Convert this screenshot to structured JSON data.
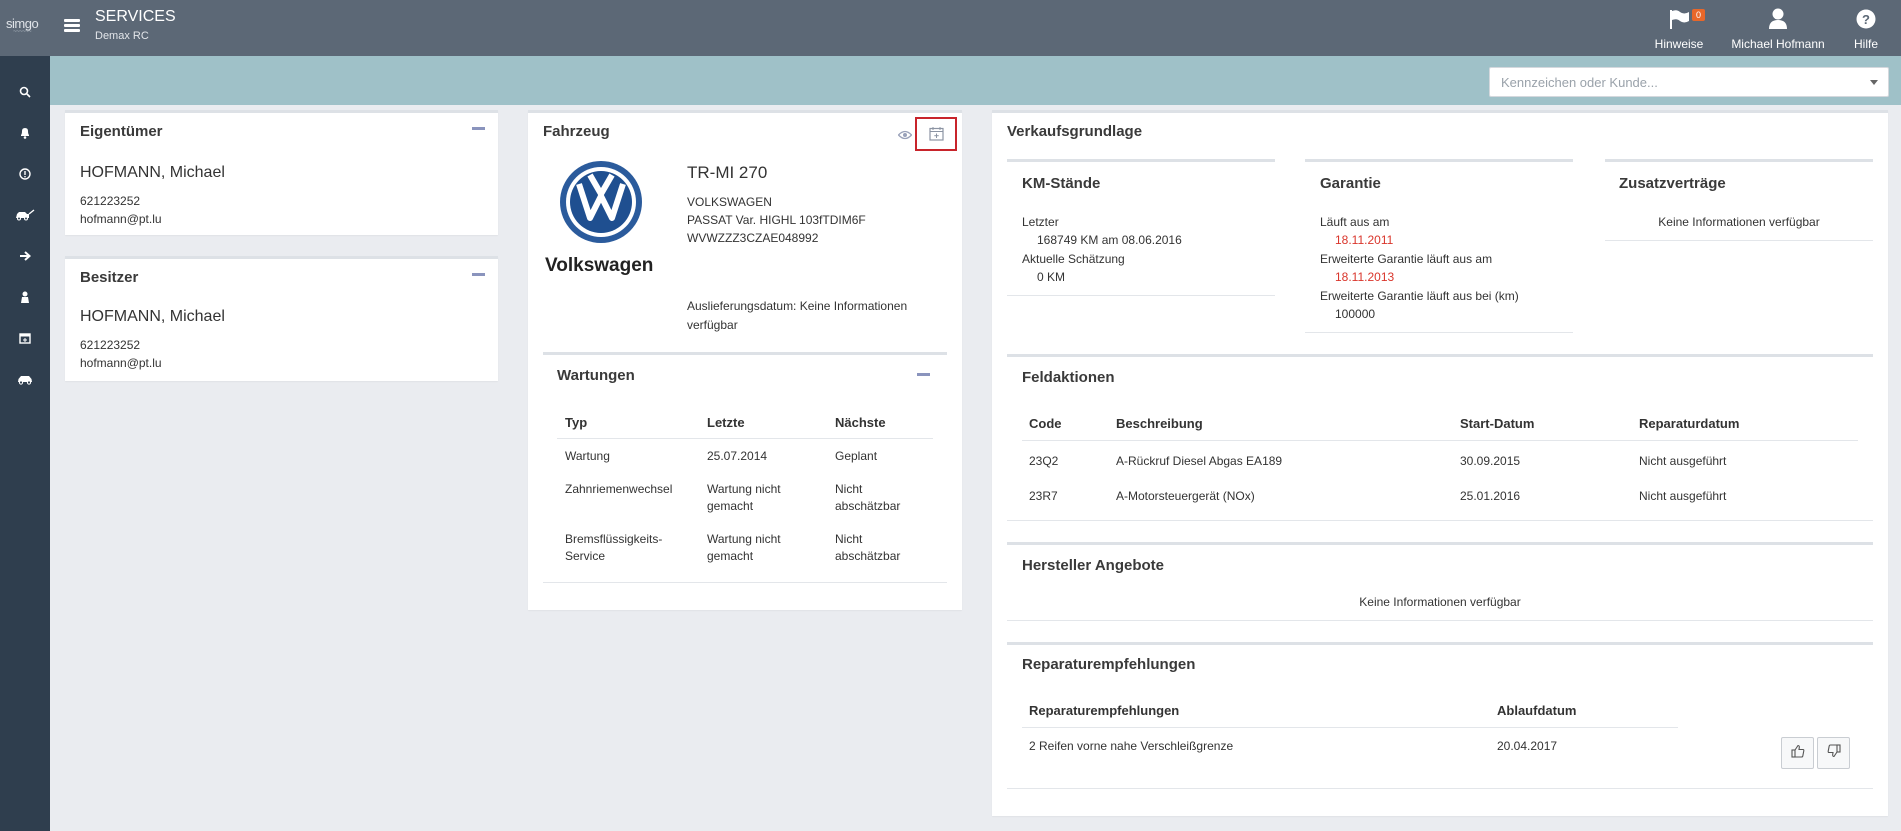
{
  "header": {
    "logo": "simgo",
    "title": "SERVICES",
    "subtitle": "Demax RC",
    "items": [
      {
        "label": "Hinweise",
        "icon": "flag-icon",
        "badge": "0"
      },
      {
        "label": "Michael Hofmann",
        "icon": "user-icon"
      },
      {
        "label": "Hilfe",
        "icon": "help-icon"
      }
    ]
  },
  "sidebar": {
    "items": [
      {
        "icon": "search-person-icon"
      },
      {
        "icon": "bell-icon"
      },
      {
        "icon": "alert-circle-icon"
      },
      {
        "icon": "car-key-icon"
      },
      {
        "icon": "arrow-right-icon"
      },
      {
        "icon": "service-person-icon"
      },
      {
        "icon": "calendar-icon"
      },
      {
        "icon": "car-icon"
      }
    ]
  },
  "search": {
    "placeholder": "Kennzeichen oder Kunde..."
  },
  "owner": {
    "title": "Eigentümer",
    "name": "HOFMANN, Michael",
    "phone": "621223252",
    "email": "hofmann@pt.lu"
  },
  "holder": {
    "title": "Besitzer",
    "name": "HOFMANN, Michael",
    "phone": "621223252",
    "email": "hofmann@pt.lu"
  },
  "vehicle": {
    "title": "Fahrzeug",
    "brand": "Volkswagen",
    "plate": "TR-MI 270",
    "make": "VOLKSWAGEN",
    "model": "PASSAT Var. HIGHL 103fTDIM6F",
    "vin": "WVWZZZ3CZAE048992",
    "delivery": "Auslieferungsdatum: Keine Informationen verfügbar"
  },
  "maintenance": {
    "title": "Wartungen",
    "headers": [
      "Typ",
      "Letzte",
      "Nächste"
    ],
    "rows": [
      {
        "type": "Wartung",
        "last": "25.07.2014",
        "next": "Geplant",
        "status": "ok"
      },
      {
        "type": "Zahnriemenwechsel",
        "last": "Wartung nicht gemacht",
        "next": "Nicht abschätzbar",
        "status": "warn"
      },
      {
        "type": "Bremsflüssigkeits-Service",
        "last": "Wartung nicht gemacht",
        "next": "Nicht abschätzbar",
        "status": "warn"
      }
    ]
  },
  "sales": {
    "title": "Verkaufsgrundlage",
    "km": {
      "title": "KM-Stände",
      "last_label": "Letzter",
      "last_value": "168749 KM am 08.06.2016",
      "estimate_label": "Aktuelle Schätzung",
      "estimate_value": "0 KM"
    },
    "warranty": {
      "title": "Garantie",
      "expires_label": "Läuft aus am",
      "expires_value": "18.11.2011",
      "ext_label": "Erweiterte Garantie läuft aus am",
      "ext_value": "18.11.2013",
      "ext_km_label": "Erweiterte Garantie läuft aus bei (km)",
      "ext_km_value": "100000"
    },
    "extra": {
      "title": "Zusatzverträge",
      "text": "Keine Informationen verfügbar"
    }
  },
  "field_actions": {
    "title": "Feldaktionen",
    "headers": [
      "Code",
      "Beschreibung",
      "Start-Datum",
      "Reparaturdatum"
    ],
    "rows": [
      {
        "code": "23Q2",
        "desc": "A-Rückruf Diesel Abgas EA189",
        "start": "30.09.2015",
        "repair": "Nicht ausgeführt"
      },
      {
        "code": "23R7",
        "desc": "A-Motorsteuergerät (NOx)",
        "start": "25.01.2016",
        "repair": "Nicht ausgeführt"
      }
    ]
  },
  "manufacturer_offers": {
    "title": "Hersteller Angebote",
    "text": "Keine Informationen verfügbar"
  },
  "repair_recs": {
    "title": "Reparaturempfehlungen",
    "headers": [
      "Reparaturempfehlungen",
      "Ablaufdatum"
    ],
    "rows": [
      {
        "text": "2 Reifen vorne nahe Verschleißgrenze",
        "date": "20.04.2017"
      }
    ]
  },
  "colors": {
    "accent_bar": "#5c6876",
    "rail": "#2f3e4e",
    "strip": "#9fc1c8",
    "red": "#d9352b",
    "green": "#2aa05a"
  }
}
